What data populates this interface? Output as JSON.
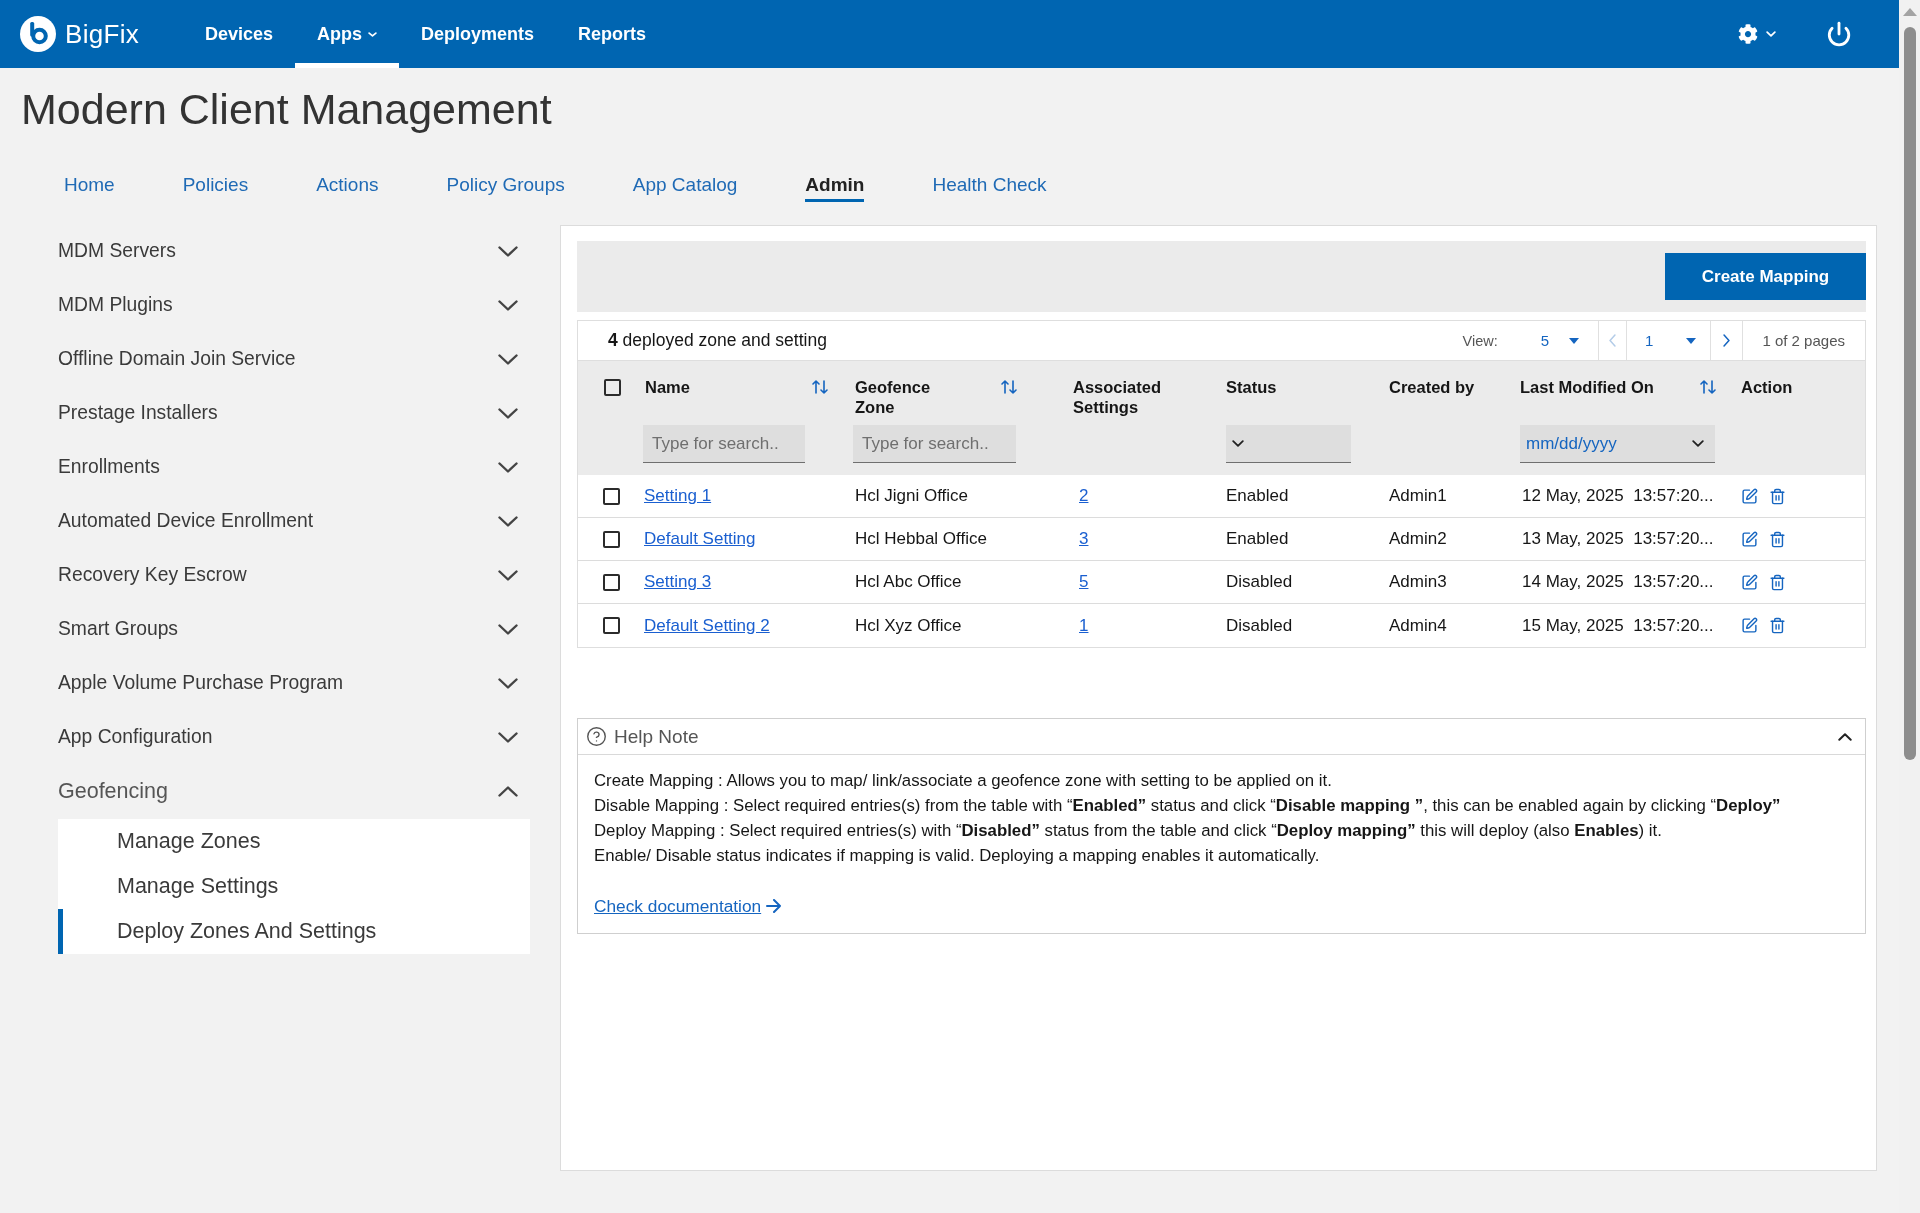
{
  "header": {
    "brand": "BigFix",
    "nav": [
      {
        "label": "Devices",
        "selected": false,
        "dropdown": false
      },
      {
        "label": "Apps",
        "selected": true,
        "dropdown": true
      },
      {
        "label": "Deployments",
        "selected": false,
        "dropdown": false
      },
      {
        "label": "Reports",
        "selected": false,
        "dropdown": false
      }
    ]
  },
  "page_title": "Modern Client Management",
  "tabs": [
    {
      "label": "Home",
      "selected": false
    },
    {
      "label": "Policies",
      "selected": false
    },
    {
      "label": "Actions",
      "selected": false
    },
    {
      "label": "Policy Groups",
      "selected": false
    },
    {
      "label": "App Catalog",
      "selected": false
    },
    {
      "label": "Admin",
      "selected": true
    },
    {
      "label": "Health Check",
      "selected": false
    }
  ],
  "sidebar": {
    "items": [
      {
        "label": "MDM Servers",
        "expanded": false
      },
      {
        "label": "MDM Plugins",
        "expanded": false
      },
      {
        "label": "Offline Domain Join Service",
        "expanded": false
      },
      {
        "label": "Prestage Installers",
        "expanded": false
      },
      {
        "label": "Enrollments",
        "expanded": false
      },
      {
        "label": "Automated Device Enrollment",
        "expanded": false
      },
      {
        "label": "Recovery Key Escrow",
        "expanded": false
      },
      {
        "label": "Smart Groups",
        "expanded": false
      },
      {
        "label": "Apple Volume Purchase Program",
        "expanded": false
      },
      {
        "label": "App Configuration",
        "expanded": false
      },
      {
        "label": "Geofencing",
        "expanded": true,
        "children": [
          {
            "label": "Manage Zones",
            "selected": false
          },
          {
            "label": "Manage Settings",
            "selected": false
          },
          {
            "label": "Deploy Zones And Settings",
            "selected": true
          }
        ]
      }
    ]
  },
  "toolbar": {
    "create_button": "Create Mapping"
  },
  "summary": "**4** deployed zone and setting",
  "pagination": {
    "view_label": "View:",
    "page_size": "5",
    "previous_disabled": true,
    "page": "1",
    "next_disabled": false,
    "page_info": "1 of 2 pages"
  },
  "table": {
    "select_all": {
      "checked": false
    },
    "columns": [
      {
        "label": "Name",
        "sortable": true,
        "filter": {
          "kind": "text",
          "placeholder": "Type for search.."
        }
      },
      {
        "label": "Geofence Zone",
        "sortable": true,
        "filter": {
          "kind": "text",
          "placeholder": "Type for search.."
        }
      },
      {
        "label": "Associated Settings",
        "sortable": false
      },
      {
        "label": "Status",
        "sortable": false,
        "filter": {
          "kind": "select"
        }
      },
      {
        "label": "Created by",
        "sortable": false
      },
      {
        "label": "Last Modified On",
        "sortable": true,
        "filter": {
          "kind": "select",
          "value": "mm/dd/yyyy"
        }
      },
      {
        "label": "Action",
        "sortable": false
      }
    ],
    "rows": [
      {
        "selected": false,
        "name": "Setting 1",
        "zone": "Hcl Jigni Office",
        "settings": "2",
        "status": "Enabled",
        "created_by": "Admin1",
        "modified": "12 May, 2025  13:57:20..."
      },
      {
        "selected": false,
        "name": "Default Setting",
        "zone": "Hcl Hebbal Office",
        "settings": "3",
        "status": "Enabled",
        "created_by": "Admin2",
        "modified": "13 May, 2025  13:57:20..."
      },
      {
        "selected": false,
        "name": "Setting 3",
        "zone": "Hcl Abc Office",
        "settings": "5",
        "status": "Disabled",
        "created_by": "Admin3",
        "modified": "14 May, 2025  13:57:20..."
      },
      {
        "selected": false,
        "name": "Default Setting 2",
        "zone": "Hcl Xyz Office",
        "settings": "1",
        "status": "Disabled",
        "created_by": "Admin4",
        "modified": "15 May, 2025  13:57:20..."
      }
    ]
  },
  "help_note": {
    "title": "Help Note",
    "expanded": true,
    "lines": [
      "Create Mapping : Allows you to map/ link/associate a geofence zone with setting to be applied on it.",
      "Disable Mapping : Select required entries(s) from the table with “**Enabled”** status and click “**Disable mapping ”**, this can be enabled again by clicking “**Deploy”**",
      "Deploy Mapping : Select required entries(s) with “**Disabled”** status from the table and click “**Deploy mapping”** this will deploy (also **Enables**) it.",
      "Enable/ Disable status indicates if mapping is valid. Deploying a mapping enables it automatically."
    ],
    "link": "Check documentation"
  }
}
